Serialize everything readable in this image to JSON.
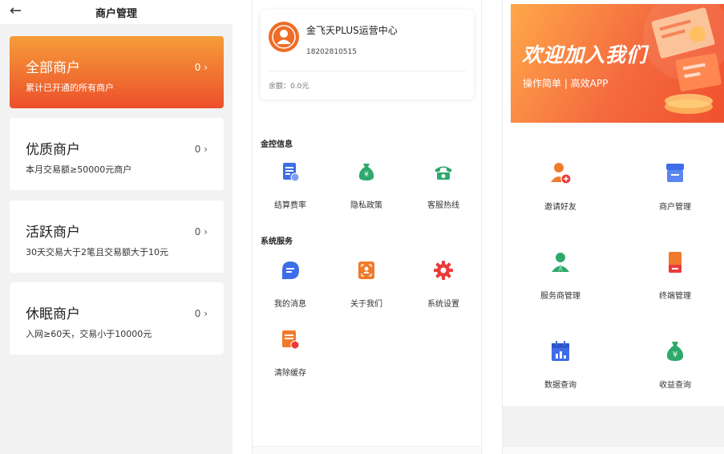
{
  "panel1": {
    "header": {
      "title": "商户管理"
    },
    "merchants": [
      {
        "name": "全部商户",
        "desc": "累计已开通的所有商户",
        "count": "0 ›"
      },
      {
        "name": "优质商户",
        "desc": "本月交易额≥50000元商户",
        "count": "0 ›"
      },
      {
        "name": "活跃商户",
        "desc": "30天交易大于2笔且交易额大于10元",
        "count": "0 ›"
      },
      {
        "name": "休眠商户",
        "desc": "入网≥60天，交易小于10000元",
        "count": "0 ›"
      }
    ]
  },
  "panel2": {
    "account": {
      "name": "金飞天PLUS运营中心",
      "phone": "18202810515",
      "balance": "余额：0.0元"
    },
    "sections": [
      {
        "title": "金控信息",
        "items": [
          {
            "label": "结算费率",
            "icon": "rate-document-icon"
          },
          {
            "label": "隐私政策",
            "icon": "money-bag-icon"
          },
          {
            "label": "客服热线",
            "icon": "telephone-icon"
          }
        ]
      },
      {
        "title": "系统服务",
        "items": [
          {
            "label": "我的消息",
            "icon": "message-bubble-icon"
          },
          {
            "label": "关于我们",
            "icon": "about-us-icon"
          },
          {
            "label": "系统设置",
            "icon": "gear-icon"
          },
          {
            "label": "清除缓存",
            "icon": "clear-cache-icon"
          }
        ]
      }
    ]
  },
  "panel3": {
    "banner": {
      "title": "欢迎加入我们",
      "subtitle": "操作简单 | 高效APP"
    },
    "grid": [
      {
        "label": "邀请好友",
        "icon": "invite-friend-icon"
      },
      {
        "label": "商户管理",
        "icon": "merchant-shop-icon"
      },
      {
        "label": "服务商管理",
        "icon": "service-provider-icon"
      },
      {
        "label": "终端管理",
        "icon": "terminal-device-icon"
      },
      {
        "label": "数据查询",
        "icon": "data-calendar-icon"
      },
      {
        "label": "收益查询",
        "icon": "income-bag-icon"
      }
    ]
  },
  "colors": {
    "accent_orange": "#f59d39",
    "accent_red": "#ec4f2b",
    "blue": "#3d6de8",
    "green": "#2ea86b",
    "icon_orange": "#f07a2b"
  }
}
